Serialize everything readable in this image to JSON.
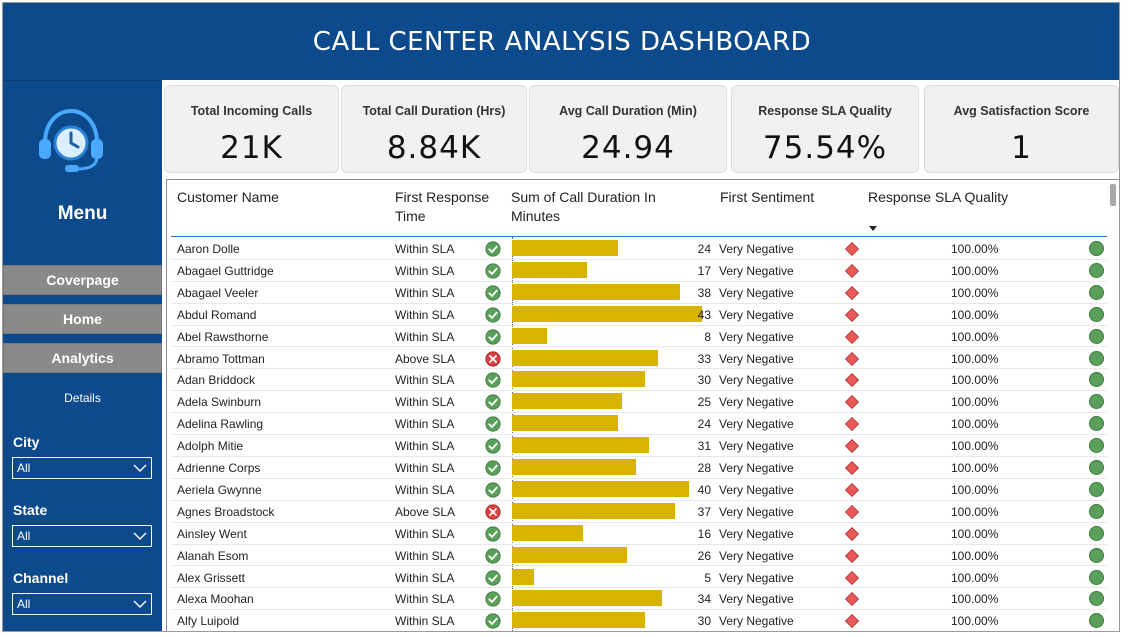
{
  "header": {
    "title": "CALL CENTER ANALYSIS DASHBOARD"
  },
  "sidebar": {
    "menu_title": "Menu",
    "nav": [
      {
        "label": "Coverpage"
      },
      {
        "label": "Home"
      },
      {
        "label": "Analytics"
      }
    ],
    "details_label": "Details",
    "filters": [
      {
        "label": "City",
        "value": "All"
      },
      {
        "label": "State",
        "value": "All"
      },
      {
        "label": "Channel",
        "value": "All"
      }
    ]
  },
  "kpis": [
    {
      "label": "Total Incoming Calls",
      "value": "21K"
    },
    {
      "label": "Total Call Duration (Hrs)",
      "value": "8.84K"
    },
    {
      "label": "Avg Call Duration (Min)",
      "value": "24.94"
    },
    {
      "label": "Response SLA Quality",
      "value": "75.54%"
    },
    {
      "label": "Avg Satisfaction Score",
      "value": "1"
    }
  ],
  "table": {
    "columns": {
      "name": "Customer Name",
      "resp_line1": "First Response",
      "resp_line2": "Time",
      "dur_line1": "Sum of Call Duration In",
      "dur_line2": "Minutes",
      "sentiment": "First Sentiment",
      "sla": "Response SLA Quality"
    },
    "max_duration": 43,
    "colors": {
      "bar": "#d8b400",
      "ok": "#5aa05a",
      "bad": "#d94040",
      "diamond": "#e85a5a"
    },
    "rows": [
      {
        "name": "Aaron Dolle",
        "response": "Within SLA",
        "duration": 24,
        "sentiment": "Very Negative",
        "sla": "100.00%"
      },
      {
        "name": "Abagael Guttridge",
        "response": "Within SLA",
        "duration": 17,
        "sentiment": "Very Negative",
        "sla": "100.00%"
      },
      {
        "name": "Abagael Veeler",
        "response": "Within SLA",
        "duration": 38,
        "sentiment": "Very Negative",
        "sla": "100.00%"
      },
      {
        "name": "Abdul Romand",
        "response": "Within SLA",
        "duration": 43,
        "sentiment": "Very Negative",
        "sla": "100.00%"
      },
      {
        "name": "Abel Rawsthorne",
        "response": "Within SLA",
        "duration": 8,
        "sentiment": "Very Negative",
        "sla": "100.00%"
      },
      {
        "name": "Abramo Tottman",
        "response": "Above SLA",
        "duration": 33,
        "sentiment": "Very Negative",
        "sla": "100.00%"
      },
      {
        "name": "Adan Briddock",
        "response": "Within SLA",
        "duration": 30,
        "sentiment": "Very Negative",
        "sla": "100.00%"
      },
      {
        "name": "Adela Swinburn",
        "response": "Within SLA",
        "duration": 25,
        "sentiment": "Very Negative",
        "sla": "100.00%"
      },
      {
        "name": "Adelina Rawling",
        "response": "Within SLA",
        "duration": 24,
        "sentiment": "Very Negative",
        "sla": "100.00%"
      },
      {
        "name": "Adolph Mitie",
        "response": "Within SLA",
        "duration": 31,
        "sentiment": "Very Negative",
        "sla": "100.00%"
      },
      {
        "name": "Adrienne Corps",
        "response": "Within SLA",
        "duration": 28,
        "sentiment": "Very Negative",
        "sla": "100.00%"
      },
      {
        "name": "Aeriela Gwynne",
        "response": "Within SLA",
        "duration": 40,
        "sentiment": "Very Negative",
        "sla": "100.00%"
      },
      {
        "name": "Agnes Broadstock",
        "response": "Above SLA",
        "duration": 37,
        "sentiment": "Very Negative",
        "sla": "100.00%"
      },
      {
        "name": "Ainsley Went",
        "response": "Within SLA",
        "duration": 16,
        "sentiment": "Very Negative",
        "sla": "100.00%"
      },
      {
        "name": "Alanah Esom",
        "response": "Within SLA",
        "duration": 26,
        "sentiment": "Very Negative",
        "sla": "100.00%"
      },
      {
        "name": "Alex Grissett",
        "response": "Within SLA",
        "duration": 5,
        "sentiment": "Very Negative",
        "sla": "100.00%"
      },
      {
        "name": "Alexa Moohan",
        "response": "Within SLA",
        "duration": 34,
        "sentiment": "Very Negative",
        "sla": "100.00%"
      },
      {
        "name": "Alfy Luipold",
        "response": "Within SLA",
        "duration": 30,
        "sentiment": "Very Negative",
        "sla": "100.00%"
      }
    ]
  }
}
